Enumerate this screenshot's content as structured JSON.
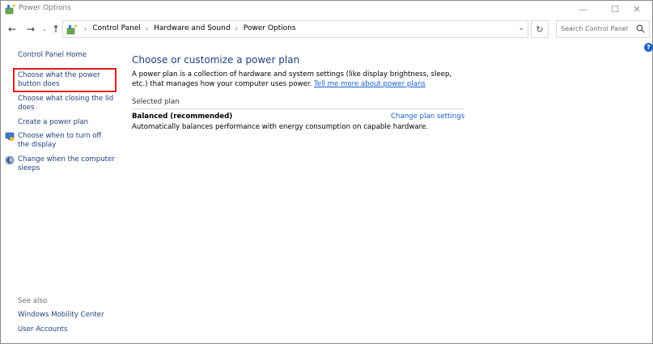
{
  "window": {
    "title": "Power Options",
    "minimize_glyph": "—",
    "maximize_glyph": "☐",
    "close_glyph": "✕"
  },
  "nav": {
    "back_glyph": "←",
    "forward_glyph": "→",
    "recent_glyph": "⌄",
    "up_glyph": "↑",
    "refresh_glyph": "↻",
    "address_dropdown_glyph": "⌄",
    "breadcrumbs": [
      "Control Panel",
      "Hardware and Sound",
      "Power Options"
    ],
    "crumb_separator": "›",
    "search_placeholder": "Search Control Panel"
  },
  "help": {
    "glyph": "?"
  },
  "left_pane": {
    "home": "Control Panel Home",
    "items": [
      {
        "label": "Choose what the power button does",
        "highlighted": true
      },
      {
        "label": "Choose what closing the lid does"
      },
      {
        "label": "Create a power plan"
      },
      {
        "label": "Choose when to turn off the display",
        "icon": "monitor-power-icon"
      },
      {
        "label": "Change when the computer sleeps",
        "icon": "moon-sleep-icon"
      }
    ],
    "see_also_heading": "See also",
    "see_also": [
      "Windows Mobility Center",
      "User Accounts"
    ]
  },
  "main": {
    "title": "Choose or customize a power plan",
    "description": "A power plan is a collection of hardware and system settings (like display brightness, sleep, etc.) that manages how your computer uses power.",
    "learn_more_link": "Tell me more about power plans",
    "selected_plan_heading": "Selected plan",
    "plan": {
      "name": "Balanced (recommended)",
      "change_link": "Change plan settings",
      "description": "Automatically balances performance with energy consumption on capable hardware."
    }
  },
  "colors": {
    "link": "#1e3f7d",
    "title_blue": "#1e3f7d",
    "highlight": "#e8191f",
    "help_blue": "#1f62c6"
  },
  "icons": {
    "app": "power-options-icon",
    "search": "search-icon"
  }
}
